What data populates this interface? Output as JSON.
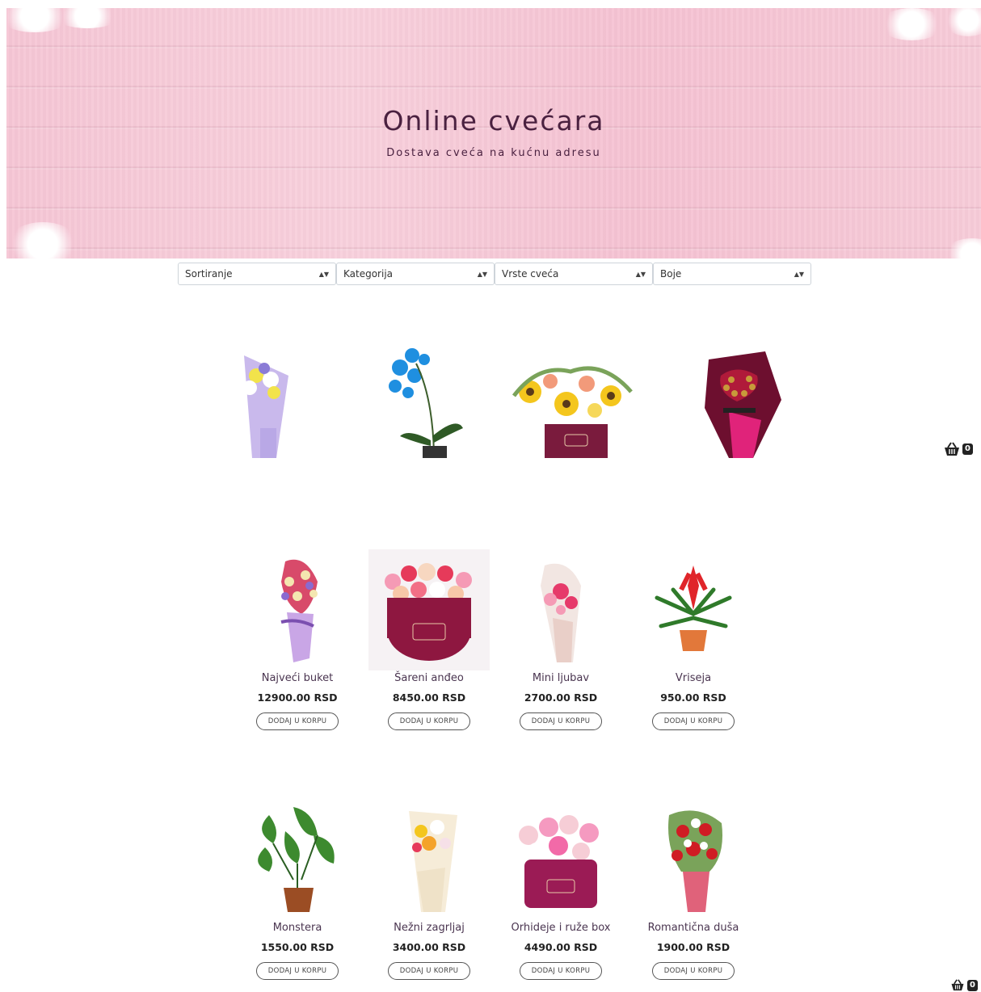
{
  "hero": {
    "title": "Online cvećara",
    "subtitle": "Dostava cveća na kućnu adresu"
  },
  "filters": [
    {
      "label": "Sortiranje"
    },
    {
      "label": "Kategorija"
    },
    {
      "label": "Vrste cveća"
    },
    {
      "label": "Boje"
    }
  ],
  "top_row": [
    {
      "image": "bouquet-lavender-wrap"
    },
    {
      "image": "blue-orchid-plant"
    },
    {
      "image": "sunflower-box"
    },
    {
      "image": "dark-red-bouquet-with-chocolates"
    }
  ],
  "products_row1": [
    {
      "name": "Najveći buket",
      "price": "12900.00 RSD",
      "button": "DODAJ U KORPU"
    },
    {
      "name": "Šareni anđeo",
      "price": "8450.00 RSD",
      "button": "DODAJ U KORPU"
    },
    {
      "name": "Mini ljubav",
      "price": "2700.00 RSD",
      "button": "DODAJ U KORPU"
    },
    {
      "name": "Vriseja",
      "price": "950.00 RSD",
      "button": "DODAJ U KORPU"
    }
  ],
  "products_row2": [
    {
      "name": "Monstera",
      "price": "1550.00 RSD",
      "button": "DODAJ U KORPU"
    },
    {
      "name": "Nežni zagrljaj",
      "price": "3400.00 RSD",
      "button": "DODAJ U KORPU"
    },
    {
      "name": "Orhideje i ruže box",
      "price": "4490.00 RSD",
      "button": "DODAJ U KORPU"
    },
    {
      "name": "Romantična duša",
      "price": "1900.00 RSD",
      "button": "DODAJ U KORPU"
    }
  ],
  "cart": {
    "count": "0",
    "icon": "basket-icon"
  },
  "colors": {
    "hero_pink": "#f6c6d5",
    "title_plum": "#4a2140"
  }
}
